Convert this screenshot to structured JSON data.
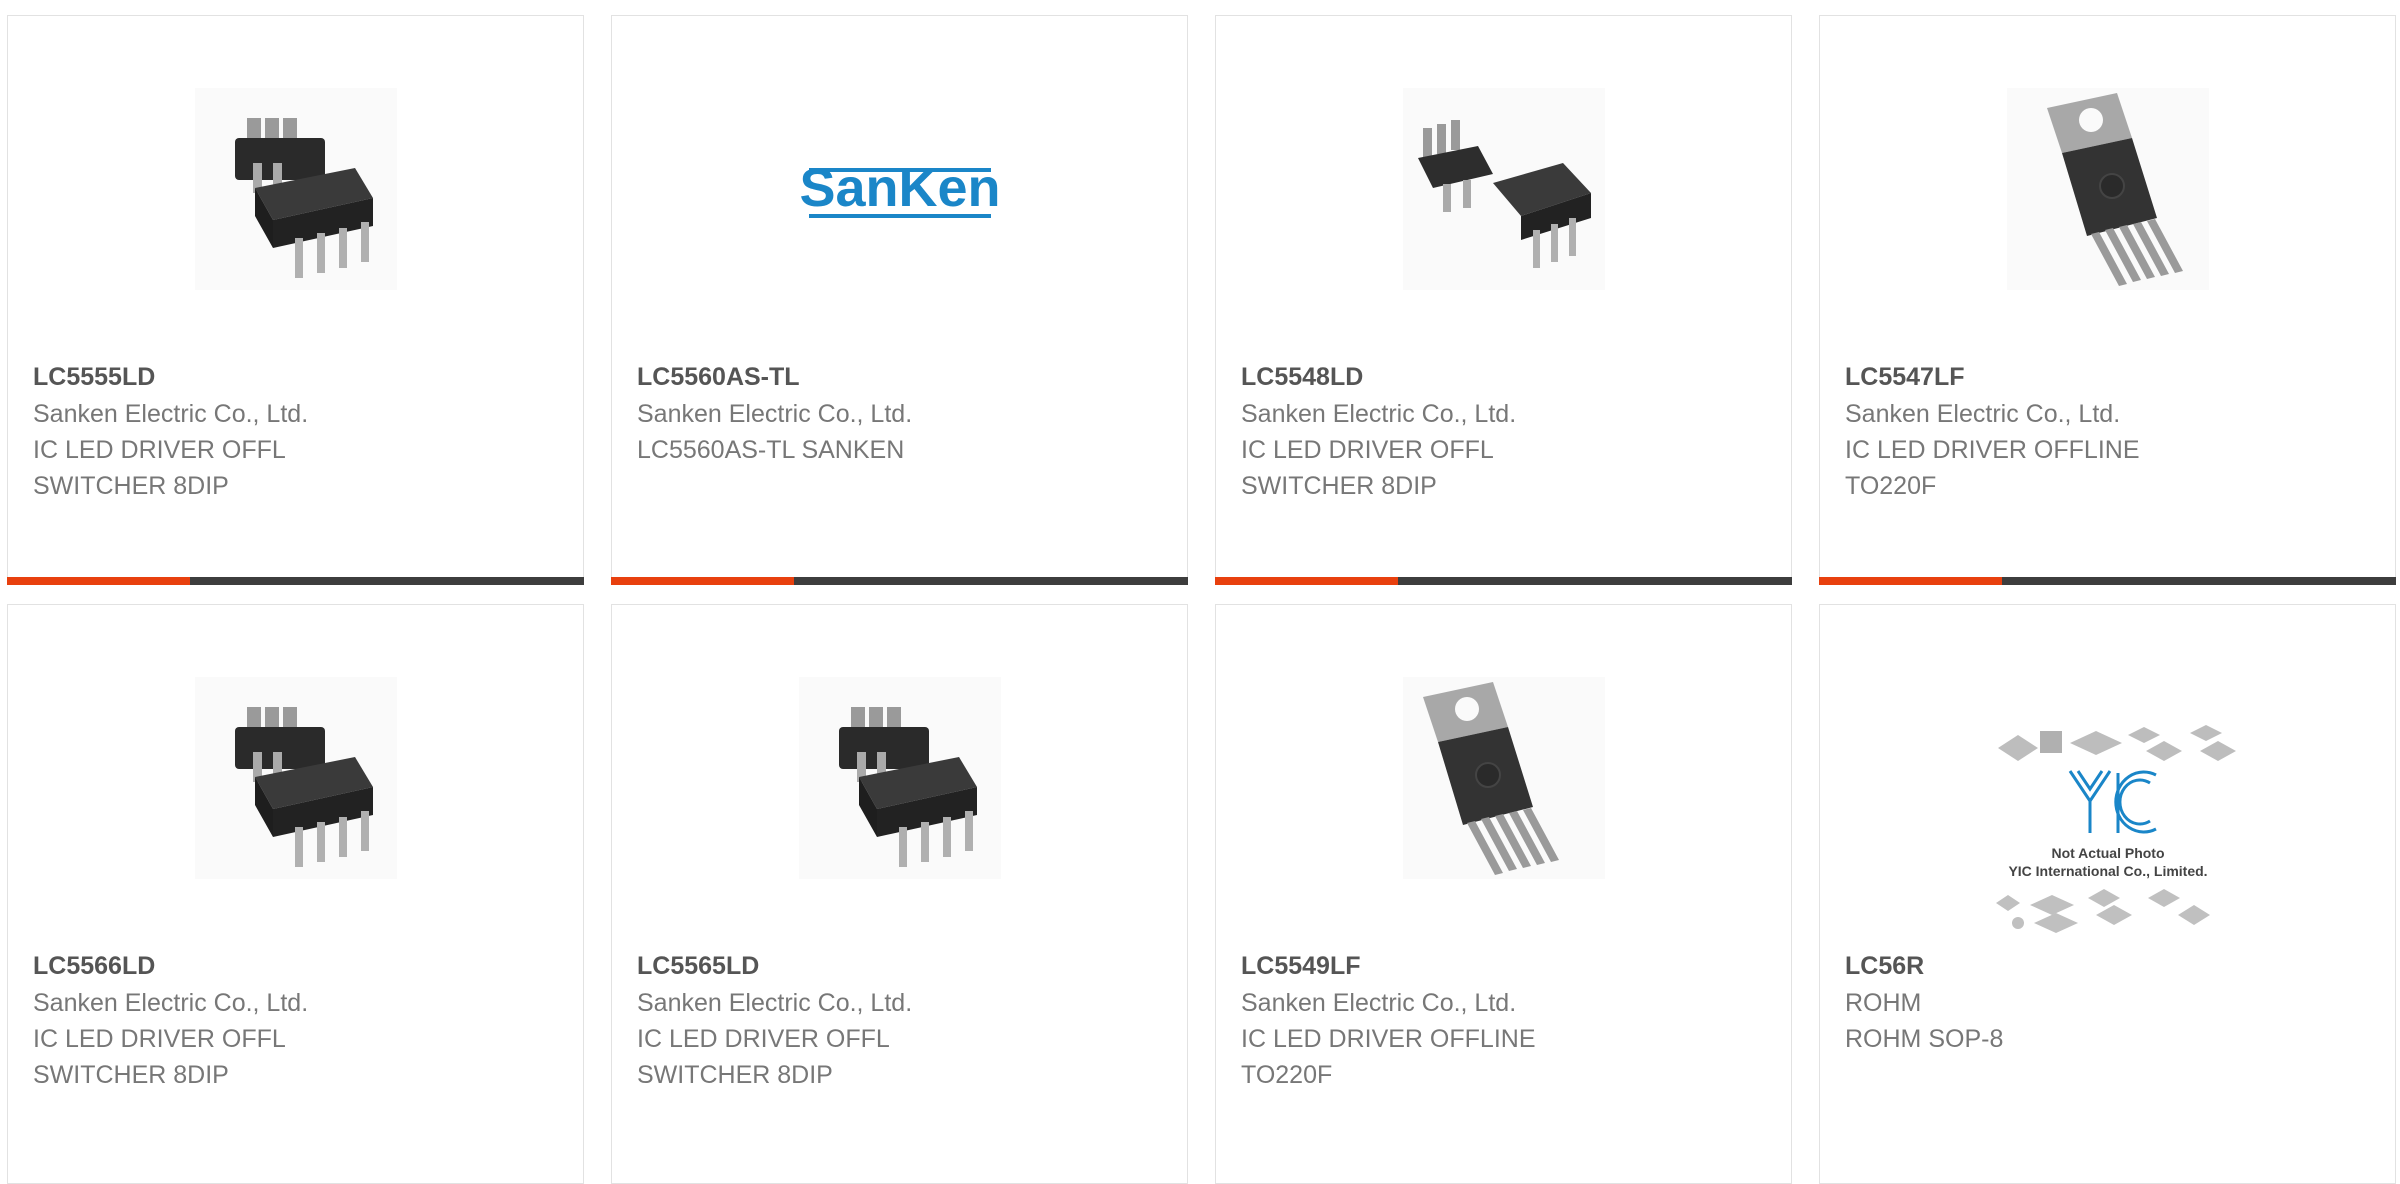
{
  "colors": {
    "accent": "#e8400e",
    "bar": "#3d3d3d",
    "part_number": "#555555",
    "text": "#777777",
    "border": "#e2e2e2"
  },
  "products": [
    {
      "part_number": "LC5555LD",
      "manufacturer": "Sanken Electric Co., Ltd.",
      "description": "IC LED DRIVER OFFL SWITCHER 8DIP",
      "image": "dip-8-package-icon"
    },
    {
      "part_number": "LC5560AS-TL",
      "manufacturer": "Sanken Electric Co., Ltd.",
      "description": "LC5560AS-TL SANKEN",
      "image": "sanken-logo",
      "logo_text": "SanKen"
    },
    {
      "part_number": "LC5548LD",
      "manufacturer": "Sanken Electric Co., Ltd.",
      "description": "IC LED DRIVER OFFL SWITCHER 8DIP",
      "image": "dip-8-package-icon"
    },
    {
      "part_number": "LC5547LF",
      "manufacturer": "Sanken Electric Co., Ltd.",
      "description": "IC LED DRIVER OFFLINE TO220F",
      "image": "to220f-package-icon"
    },
    {
      "part_number": "LC5566LD",
      "manufacturer": "Sanken Electric Co., Ltd.",
      "description": "IC LED DRIVER OFFL SWITCHER 8DIP",
      "image": "dip-8-package-icon"
    },
    {
      "part_number": "LC5565LD",
      "manufacturer": "Sanken Electric Co., Ltd.",
      "description": "IC LED DRIVER OFFL SWITCHER 8DIP",
      "image": "dip-8-package-icon"
    },
    {
      "part_number": "LC5549LF",
      "manufacturer": "Sanken Electric Co., Ltd.",
      "description": "IC LED DRIVER OFFLINE TO220F",
      "image": "to220f-package-icon"
    },
    {
      "part_number": "LC56R",
      "manufacturer": "ROHM",
      "description": "ROHM SOP-8",
      "image": "placeholder-not-actual-photo",
      "placeholder_lines": [
        "Not Actual Photo",
        "YIC International Co., Limited."
      ]
    }
  ]
}
